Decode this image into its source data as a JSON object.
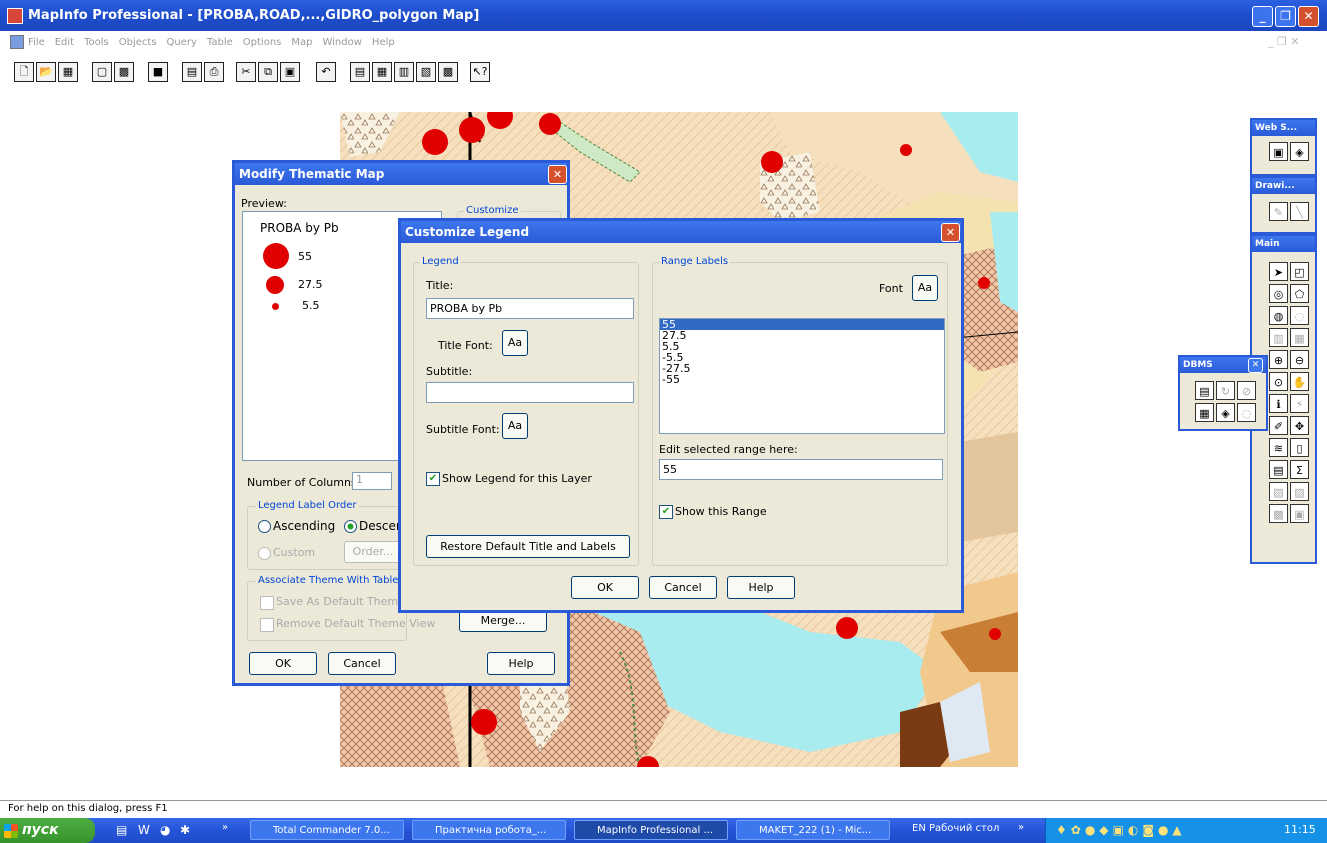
{
  "window": {
    "title": "MapInfo Professional - [PROBA,ROAD,...,GIDRO_polygon Map]"
  },
  "menu": [
    "File",
    "Edit",
    "Tools",
    "Objects",
    "Query",
    "Table",
    "Options",
    "Map",
    "Window",
    "Help"
  ],
  "toolbar": {
    "icons": [
      "new-icon",
      "open-icon",
      "open-workspace-icon",
      "save-icon",
      "save-workspace-icon",
      "close-icon",
      "print-icon",
      "print-preview-icon",
      "cut-icon",
      "copy-icon",
      "paste-icon",
      "undo-icon",
      "new-browser-icon",
      "new-mapper-icon",
      "new-grapher-icon",
      "new-layout-icon",
      "new-redistrict-icon",
      "help-pointer-icon"
    ]
  },
  "status": {
    "text": "For help on this dialog, press F1"
  },
  "taskbar": {
    "start": "пуск",
    "tasks": [
      "Total Commander 7.0...",
      "Практична робота_...",
      "MapInfo Professional ...",
      "MAKET_222 (1) - Mic...",
      "EN  Рабочий стол"
    ],
    "clock": "11:15"
  },
  "modify": {
    "title": "Modify Thematic Map",
    "preview_label": "Preview:",
    "legend_title": "PROBA by Pb",
    "legend_values": [
      "55",
      "27.5",
      "5.5"
    ],
    "customize_label": "Customize",
    "num_columns_label": "Number of Columns:",
    "num_columns_value": "1",
    "order_group": "Legend Label Order",
    "ascending": "Ascending",
    "descending": "Descen",
    "custom": "Custom",
    "order_btn": "Order...",
    "assoc_group": "Associate Theme With Table",
    "save_default": "Save As Default Theme V",
    "remove_default": "Remove Default Theme View",
    "merge": "Merge...",
    "ok": "OK",
    "cancel": "Cancel",
    "help": "Help"
  },
  "customize": {
    "title": "Customize Legend",
    "legend_group": "Legend",
    "title_label": "Title:",
    "title_value": "PROBA by Pb",
    "title_font_label": "Title Font:",
    "subtitle_label": "Subtitle:",
    "subtitle_value": "",
    "subtitle_font_label": "Subtitle Font:",
    "font_btn": "Aa",
    "show_legend": "Show Legend for this Layer",
    "restore": "Restore Default Title and Labels",
    "range_group": "Range Labels",
    "font_label": "Font",
    "ranges": [
      "55",
      "27.5",
      "5.5",
      "-5.5",
      "-27.5",
      "-55"
    ],
    "selected_range": "55",
    "edit_label": "Edit selected range here:",
    "edit_value": "55",
    "show_range": "Show this Range",
    "ok": "OK",
    "cancel": "Cancel",
    "help": "Help"
  },
  "palettes": {
    "web": "Web S...",
    "drawing": "Drawi...",
    "main": "Main",
    "dbms": "DBMS"
  },
  "colors": {
    "title_blue": "#2a5ad8",
    "dialog_bg": "#ece9d8",
    "point_red": "#e00000",
    "water": "#a8ecf0",
    "selection": "#316ac5"
  }
}
